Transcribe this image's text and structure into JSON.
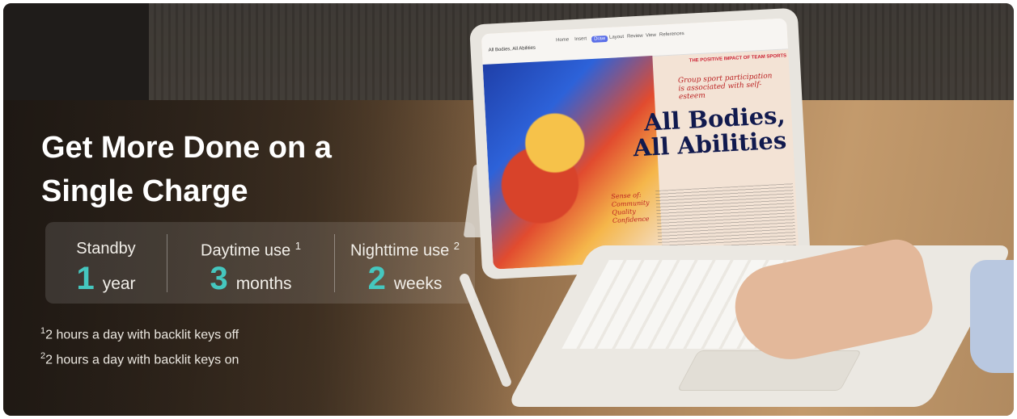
{
  "headline": {
    "line1": "Get More Done on a",
    "line2": "Single Charge"
  },
  "specs": [
    {
      "label": "Standby",
      "superscript": "",
      "value": "1",
      "unit": "year"
    },
    {
      "label": "Daytime use",
      "superscript": "1",
      "value": "3",
      "unit": "months"
    },
    {
      "label": "Nighttime use",
      "superscript": "2",
      "value": "2",
      "unit": "weeks"
    }
  ],
  "footnotes": [
    {
      "marker": "1",
      "text": "2 hours a day with backlit keys off"
    },
    {
      "marker": "2",
      "text": "2 hours a day with backlit keys on"
    }
  ],
  "device_screen": {
    "doc_title": "All Bodies, All Abilities",
    "tabs": [
      "Home",
      "Insert",
      "Draw",
      "Layout",
      "Review",
      "View",
      "References"
    ],
    "active_tab": "Draw",
    "kicker": "THE POSITIVE IMPACT OF TEAM SPORTS",
    "heading_line1": "All Bodies,",
    "heading_line2": "All Abilities",
    "handwriting": "Group sport participation is associated with self-esteem",
    "notes": [
      "Sense of:",
      "Community",
      "Quality",
      "Confidence"
    ]
  },
  "colors": {
    "accent_teal": "#45c7bf",
    "heading_navy": "#111a4e",
    "text_white": "#ffffff"
  }
}
